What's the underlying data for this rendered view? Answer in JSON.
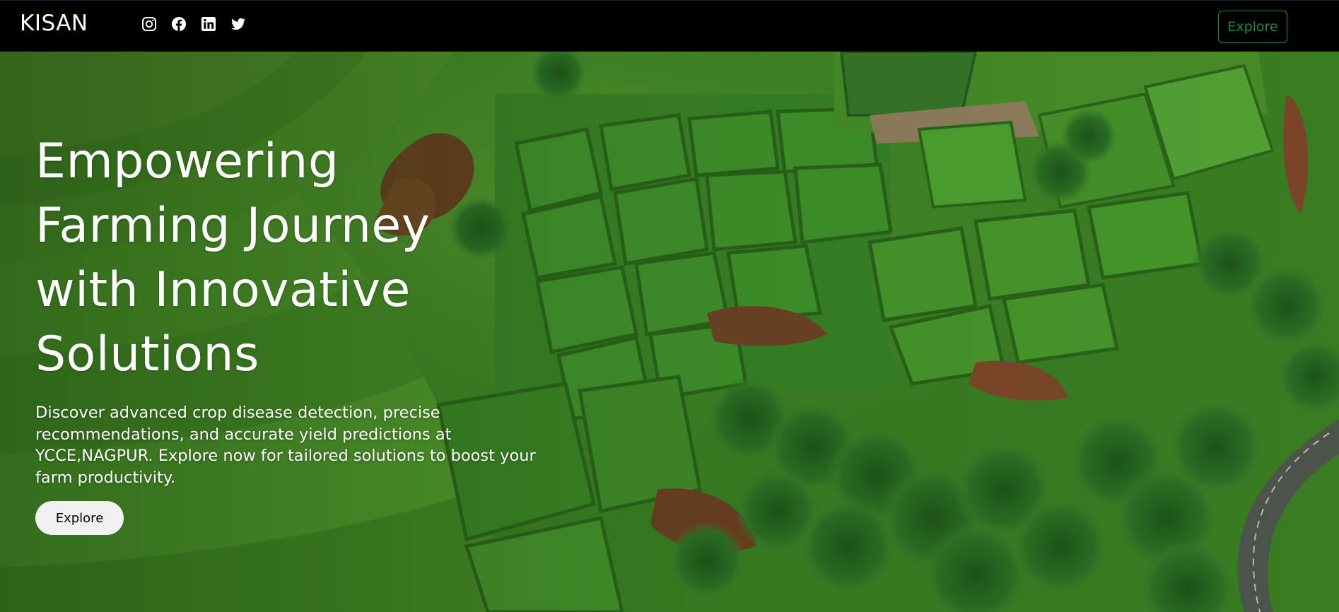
{
  "nav": {
    "brand": "KISAN",
    "social_icons": [
      "instagram-icon",
      "facebook-icon",
      "linkedin-icon",
      "twitter-icon"
    ],
    "explore_label": "Explore",
    "accent_color": "#198754"
  },
  "hero": {
    "title": "Empowering Farming Journey with Innovative Solutions",
    "description": "Discover advanced crop disease detection, precise recommendations, and accurate yield predictions at YCCE,NAGPUR. Explore now for tailored solutions to boost your farm productivity.",
    "button_label": "Explore"
  }
}
